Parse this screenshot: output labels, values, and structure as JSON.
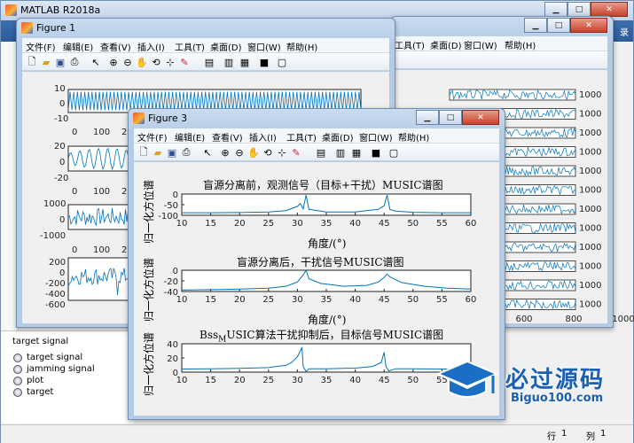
{
  "desktop": {
    "matlab_title": "MATLAB R2018a",
    "left_panel_label": "target signal",
    "workspace_items": [
      "target signal",
      "jamming signal",
      "plot",
      "target"
    ],
    "status_row": "行",
    "status_row_val": "1",
    "status_col": "列",
    "status_col_val": "1",
    "side_glyph": "录"
  },
  "figure1": {
    "title": "Figure 1",
    "menu": [
      "文件(F)",
      "编辑(E)",
      "查看(V)",
      "插入(I)",
      "工具(T)",
      "桌面(D)",
      "窗口(W)",
      "帮助(H)"
    ],
    "subplots": [
      {
        "yticks": [
          "10",
          "0",
          "-10"
        ],
        "xticks": [
          "0",
          "100",
          "200"
        ]
      },
      {
        "yticks": [
          "20",
          "0",
          "-20"
        ],
        "xticks": [
          "0",
          "100",
          "200"
        ]
      },
      {
        "yticks": [
          "1000",
          "0",
          "-1000"
        ],
        "xticks": [
          "0",
          "100",
          "200"
        ]
      },
      {
        "yticks": [
          "200",
          "0",
          "-200",
          "-400",
          "-600"
        ],
        "xticks": [
          "0",
          "100",
          "200"
        ]
      }
    ]
  },
  "figure_back": {
    "menu": [
      "文件(F)",
      "编辑(E)",
      "查看(V)",
      "插入(I)",
      "工具(T)",
      "桌面(D)",
      "窗口(W)",
      "帮助(H)"
    ],
    "right_ticks": [
      "1000",
      "1000",
      "1000",
      "1000",
      "1000",
      "1000",
      "1000",
      "1000",
      "1000",
      "1000",
      "1000",
      "1000"
    ],
    "xticks": [
      "600",
      "800",
      "1000"
    ]
  },
  "figure3": {
    "title": "Figure 3",
    "menu": [
      "文件(F)",
      "编辑(E)",
      "查看(V)",
      "插入(I)",
      "工具(T)",
      "桌面(D)",
      "窗口(W)",
      "帮助(H)"
    ],
    "ylabel": "归一化方位谱",
    "xlabel": "角度/(°)",
    "plots": [
      {
        "title": "盲源分离前，观测信号（目标+干扰）MUSIC谱图",
        "yticks": [
          "0",
          "-50",
          "-100"
        ]
      },
      {
        "title": "盲源分离后，干扰信号MUSIC谱图",
        "yticks": [
          "0",
          "-20",
          "-40"
        ]
      },
      {
        "title_pre": "Bss",
        "title_sub": "M",
        "title_post": "USIC算法干扰抑制后，目标信号MUSIC谱图",
        "yticks": [
          "40",
          "20",
          "0"
        ]
      }
    ],
    "xticks": [
      "10",
      "15",
      "20",
      "25",
      "30",
      "35",
      "40",
      "45",
      "50",
      "55",
      "60"
    ]
  },
  "watermark": {
    "main": "必过源码",
    "sub": "Biguo100.com"
  },
  "chart_data": [
    {
      "type": "line",
      "title": "盲源分离前，观测信号（目标+干扰）MUSIC谱图",
      "xlim": [
        10,
        60
      ],
      "ylim": [
        -100,
        0
      ],
      "xlabel": "角度/(°)",
      "ylabel": "归一化方位谱",
      "x": [
        10,
        15,
        20,
        25,
        28,
        30,
        30.5,
        31,
        31.5,
        32,
        35,
        40,
        44,
        45,
        45.5,
        46,
        47,
        50,
        55,
        60
      ],
      "y": [
        -88,
        -88,
        -87,
        -84,
        -78,
        -58,
        -45,
        -70,
        -5,
        -72,
        -84,
        -84,
        -72,
        -55,
        -5,
        -72,
        -80,
        -86,
        -88,
        -88
      ]
    },
    {
      "type": "line",
      "title": "盲源分离后，干扰信号MUSIC谱图",
      "xlim": [
        10,
        60
      ],
      "ylim": [
        -45,
        0
      ],
      "xlabel": "角度/(°)",
      "ylabel": "归一化方位谱",
      "x": [
        10,
        15,
        20,
        25,
        28,
        30,
        31,
        31.5,
        32,
        34,
        38,
        42,
        44,
        45,
        45.5,
        46,
        48,
        52,
        56,
        60
      ],
      "y": [
        -42,
        -41,
        -40,
        -38,
        -34,
        -25,
        -10,
        0,
        -18,
        -28,
        -34,
        -32,
        -25,
        -15,
        -8,
        -14,
        -26,
        -34,
        -38,
        -40
      ]
    },
    {
      "type": "line",
      "title": "BssMUSIC算法干扰抑制后，目标信号MUSIC谱图",
      "xlim": [
        10,
        60
      ],
      "ylim": [
        -5,
        45
      ],
      "xlabel": "角度/(°)",
      "ylabel": "归一化方位谱",
      "x": [
        10,
        15,
        20,
        25,
        28,
        29,
        30,
        30.8,
        31,
        31.5,
        32,
        35,
        40,
        43,
        44.5,
        45,
        45.3,
        45.8,
        47,
        50,
        55,
        60
      ],
      "y": [
        0.5,
        1,
        1.5,
        3,
        7,
        12,
        22,
        38,
        5,
        -4,
        1,
        1,
        2,
        5,
        12,
        30,
        5,
        -3,
        1,
        1,
        0.5,
        0.3
      ]
    }
  ]
}
